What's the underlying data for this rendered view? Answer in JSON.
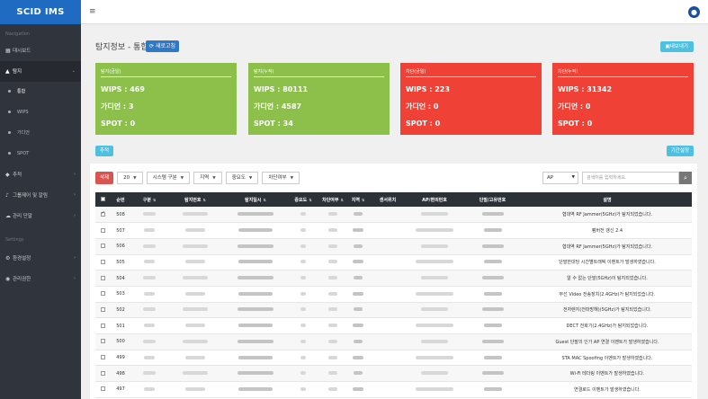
{
  "brand": "SCID IMS",
  "topbar": {
    "menu_icon": "≡",
    "user_icon": "person"
  },
  "sidebar": {
    "section_navigation": "Navigation",
    "dashboard": "대시보드",
    "detect": "탐지",
    "sub": [
      "통합",
      "WIPS",
      "가디언",
      "SPOT"
    ],
    "track": "추적",
    "group_alarm": "그룹제어 및 알림",
    "assets": "관리 단말",
    "section_settings": "Settings",
    "env": "환경설정",
    "admin": "관리권한"
  },
  "page": {
    "title": "탐지정보 - 통합",
    "refresh_label": "새로고침",
    "export_label": "내보내기",
    "track_label": "추적",
    "period_label": "기간설정"
  },
  "cards": [
    {
      "title": "탐지(금일)",
      "wips": "WIPS : 469",
      "guardian": "가디언 : 3",
      "spot": "SPOT : 0",
      "color": "#8cc04b"
    },
    {
      "title": "탐지(누적)",
      "wips": "WIPS : 80111",
      "guardian": "가디언 : 4587",
      "spot": "SPOT : 34",
      "color": "#8cc04b"
    },
    {
      "title": "차단(금일)",
      "wips": "WIPS : 223",
      "guardian": "가디언 : 0",
      "spot": "SPOT : 0",
      "color": "#ef4136"
    },
    {
      "title": "차단(누적)",
      "wips": "WIPS : 31342",
      "guardian": "가디언 : 0",
      "spot": "SPOT : 0",
      "color": "#ef4136"
    }
  ],
  "filters": {
    "delete_label": "삭제",
    "page_size": "20",
    "system_type": "시스템 구분",
    "region": "지역",
    "importance": "중요도",
    "block": "차단여부",
    "search_type": "AP",
    "search_placeholder": "검색어를 입력하세요."
  },
  "table": {
    "headers": [
      "순번",
      "구분",
      "탐지번호",
      "탐지일시",
      "중요도",
      "차단여부",
      "지역",
      "센서위치",
      "AP/편의번호",
      "단말/고유번호",
      "설명"
    ],
    "rows": [
      {
        "no": "508",
        "checked": true,
        "desc": "협대역 RF Jammer(5GHz)가 탐지되었습니다."
      },
      {
        "no": "507",
        "checked": false,
        "desc": "펌버전 갱신 2.4"
      },
      {
        "no": "506",
        "checked": false,
        "desc": "협대역 RF Jammer(5GHz)가 탐지되었습니다."
      },
      {
        "no": "505",
        "checked": false,
        "desc": "단말한대당 시간별트래픽 이벤트가 발생하였습니다."
      },
      {
        "no": "504",
        "checked": false,
        "desc": "알 수 없는 단말(5GHz)이 탐지되었습니다."
      },
      {
        "no": "503",
        "checked": false,
        "desc": "무선 Video 전송장치(2.4GHz)가 탐지되었습니다."
      },
      {
        "no": "502",
        "checked": false,
        "desc": "전자렌지(전파방해)(5GHz)가 탐지되었습니다."
      },
      {
        "no": "501",
        "checked": false,
        "desc": "DECT 전화기(2.4GHz)가 탐지되었습니다."
      },
      {
        "no": "500",
        "checked": false,
        "desc": "Guest 단말의 인가 AP 연결 이벤트가 발생하였습니다."
      },
      {
        "no": "499",
        "checked": false,
        "desc": "STA MAC Spoofing 이벤트가 발생하였습니다."
      },
      {
        "no": "498",
        "checked": false,
        "desc": "Wi-Fi 테더링 이벤트가 발생하였습니다."
      },
      {
        "no": "497",
        "checked": false,
        "desc": "연결로드 이벤트가 발생하였습니다."
      }
    ]
  }
}
